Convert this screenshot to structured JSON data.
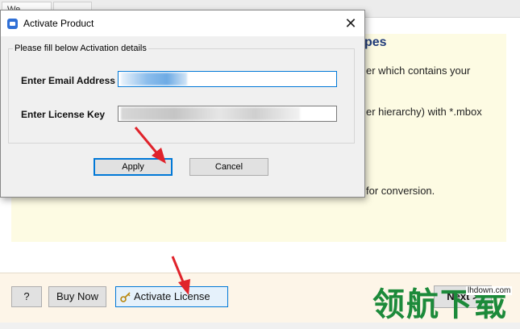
{
  "background_app": {
    "tabs": [
      "We",
      ""
    ],
    "heading_fragment": "pes",
    "text_fragments": [
      "er which contains your",
      "er hierarchy) with *.mbox",
      "for conversion."
    ],
    "buttons": {
      "help_label": "?",
      "buy_label": "Buy Now",
      "activate_label": "Activate License",
      "next_label": "Next >"
    }
  },
  "dialog": {
    "title": "Activate Product",
    "close_glyph": "✕",
    "group_legend": "Please fill below Activation details",
    "email_label": "Enter Email Address",
    "license_label": "Enter License Key",
    "apply_label": "Apply",
    "cancel_label": "Cancel"
  },
  "watermark": {
    "logo_text": "领航下载",
    "url_text": "lhdown.com"
  },
  "colors": {
    "accent": "#0078d7",
    "annotation_arrow": "#e0232b",
    "watermark_green": "#1c8a3a",
    "panel_yellow": "#fdfbe3"
  },
  "icons": [
    "app-logo-icon",
    "close-icon",
    "key-icon",
    "red-arrow-annotation"
  ]
}
